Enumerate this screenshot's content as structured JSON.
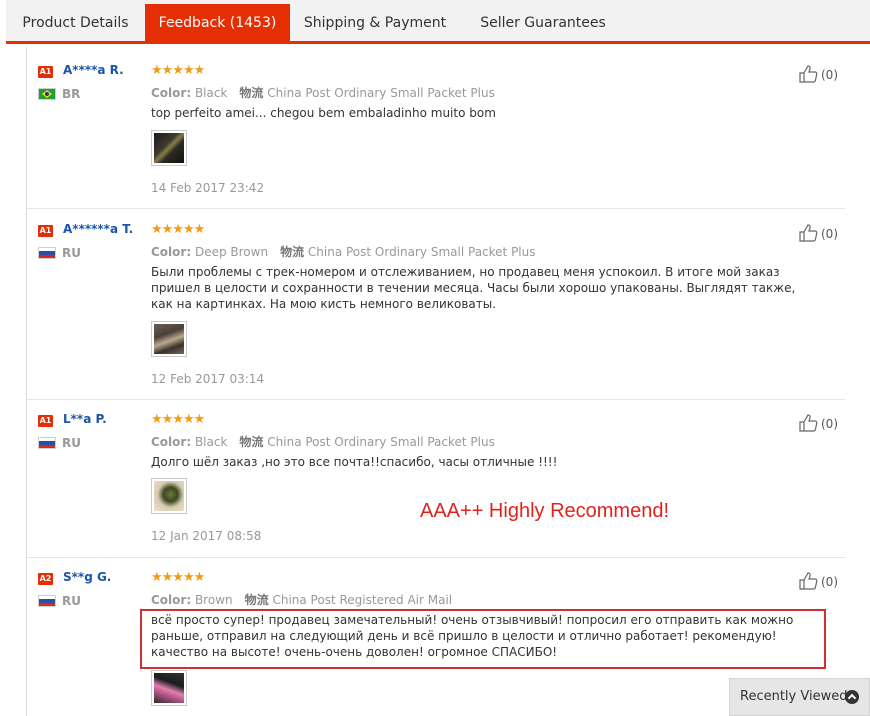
{
  "tabs": [
    {
      "label": "Product Details"
    },
    {
      "label": "Feedback (1453)"
    },
    {
      "label": "Shipping & Payment"
    },
    {
      "label": "Seller Guarantees"
    }
  ],
  "reviews": [
    {
      "level": "A1",
      "name": "A****a R.",
      "country": "BR",
      "flag": "brazil-flag-icon",
      "rating": 5,
      "stars": "★★★★★",
      "color_label": "Color:",
      "color_value": "Black",
      "shipping_cn": "物流",
      "shipping": "China Post Ordinary Small Packet Plus",
      "text": "top perfeito amei... chegou bem embaladinho muito bom",
      "date": "14 Feb 2017 23:42",
      "likes": "(0)"
    },
    {
      "level": "A1",
      "name": "A******a T.",
      "country": "RU",
      "flag": "russia-flag-icon",
      "rating": 5,
      "stars": "★★★★★",
      "color_label": "Color:",
      "color_value": "Deep Brown",
      "shipping_cn": "物流",
      "shipping": "China Post Ordinary Small Packet Plus",
      "text": "Были проблемы с трек-номером и отслеживанием, но продавец меня успокоил. В итоге мой заказ пришел в целости и сохранности в течении месяца. Часы были хорошо упакованы. Выглядят также, как на картинках. На мою кисть немного великоваты.",
      "date": "12 Feb 2017 03:14",
      "likes": "(0)"
    },
    {
      "level": "A1",
      "name": "L**a P.",
      "country": "RU",
      "flag": "russia-flag-icon",
      "rating": 5,
      "stars": "★★★★★",
      "color_label": "Color:",
      "color_value": "Black",
      "shipping_cn": "物流",
      "shipping": "China Post Ordinary Small Packet Plus",
      "text": "Долго шёл заказ ,но это все почта!!спасибо, часы отличные !!!!",
      "date": "12 Jan 2017 08:58",
      "likes": "(0)"
    },
    {
      "level": "A2",
      "name": "S**g G.",
      "country": "RU",
      "flag": "russia-flag-icon",
      "rating": 5,
      "stars": "★★★★★",
      "color_label": "Color:",
      "color_value": "Brown",
      "shipping_cn": "物流",
      "shipping": "China Post Registered Air Mail",
      "text": "всё просто супер! продавец замечательный! очень отзывчивый! попросил его отправить как можно раньше, отправил на следующий день и всё пришло в целости и отлично работает! рекомендую! качество на высоте! очень-очень доволен! огромное СПАСИБО!",
      "likes": "(0)"
    }
  ],
  "annotation": "AAA++ Highly Recommend!",
  "recently_viewed": "Recently Viewed",
  "colors": {
    "accent": "#e62e04",
    "link": "#1a56a8",
    "star": "#f19b19",
    "annotation": "#e0231c"
  }
}
